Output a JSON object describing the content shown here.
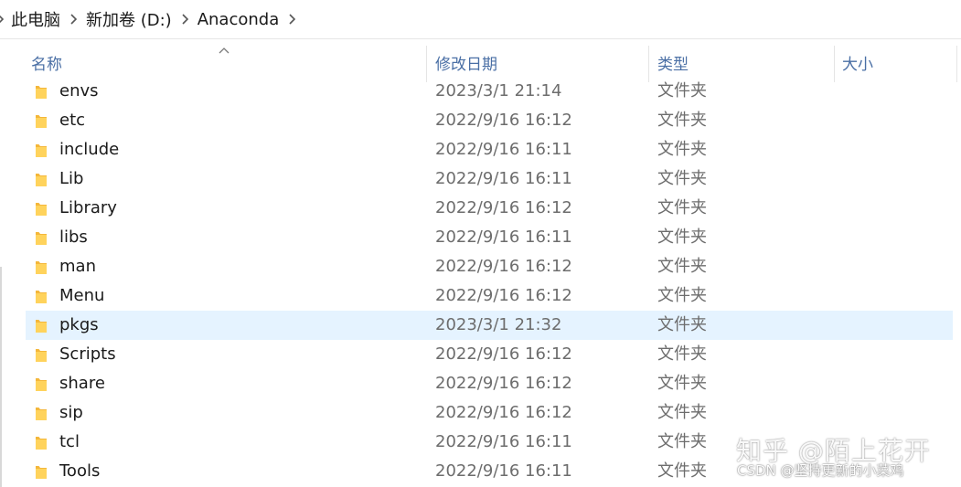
{
  "breadcrumb": {
    "items": [
      {
        "label": "此电脑"
      },
      {
        "label": "新加卷 (D:)"
      },
      {
        "label": "Anaconda"
      }
    ]
  },
  "columns": {
    "name": "名称",
    "date": "修改日期",
    "type": "类型",
    "size": "大小"
  },
  "colors": {
    "header_text": "#4a6fa5",
    "selected_row": "#e5f3ff",
    "folder_yellow": "#f7c948"
  },
  "files": [
    {
      "name": "envs",
      "date": "2023/3/1 21:14",
      "type": "文件夹",
      "size": ""
    },
    {
      "name": "etc",
      "date": "2022/9/16 16:12",
      "type": "文件夹",
      "size": ""
    },
    {
      "name": "include",
      "date": "2022/9/16 16:11",
      "type": "文件夹",
      "size": ""
    },
    {
      "name": "Lib",
      "date": "2022/9/16 16:11",
      "type": "文件夹",
      "size": ""
    },
    {
      "name": "Library",
      "date": "2022/9/16 16:12",
      "type": "文件夹",
      "size": ""
    },
    {
      "name": "libs",
      "date": "2022/9/16 16:11",
      "type": "文件夹",
      "size": ""
    },
    {
      "name": "man",
      "date": "2022/9/16 16:12",
      "type": "文件夹",
      "size": ""
    },
    {
      "name": "Menu",
      "date": "2022/9/16 16:12",
      "type": "文件夹",
      "size": ""
    },
    {
      "name": "pkgs",
      "date": "2023/3/1 21:32",
      "type": "文件夹",
      "size": "",
      "selected": true
    },
    {
      "name": "Scripts",
      "date": "2022/9/16 16:12",
      "type": "文件夹",
      "size": ""
    },
    {
      "name": "share",
      "date": "2022/9/16 16:12",
      "type": "文件夹",
      "size": ""
    },
    {
      "name": "sip",
      "date": "2022/9/16 16:12",
      "type": "文件夹",
      "size": ""
    },
    {
      "name": "tcl",
      "date": "2022/9/16 16:11",
      "type": "文件夹",
      "size": ""
    },
    {
      "name": "Tools",
      "date": "2022/9/16 16:11",
      "type": "文件夹",
      "size": ""
    }
  ],
  "watermark": {
    "line1": "知乎 @陌上花开",
    "line2": "CSDN @坚持更新的小菜鸡"
  }
}
